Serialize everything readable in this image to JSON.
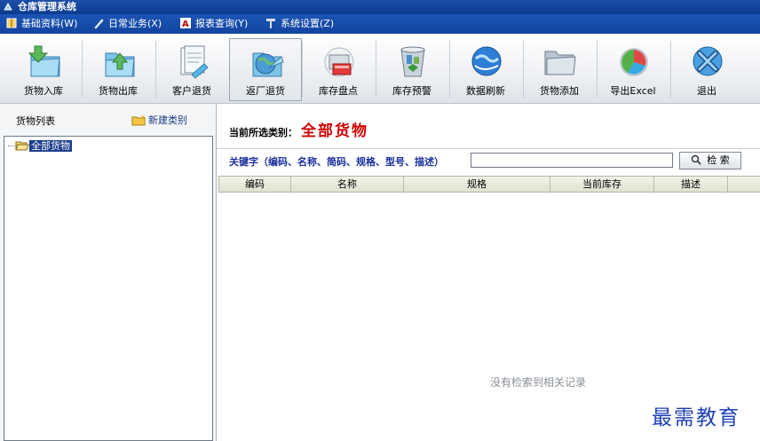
{
  "window": {
    "title": "仓库管理系统"
  },
  "menu": [
    {
      "label": "基础资料(W)",
      "icon": "book-icon"
    },
    {
      "label": "日常业务(X)",
      "icon": "pen-icon"
    },
    {
      "label": "报表查询(Y)",
      "icon": "report-icon"
    },
    {
      "label": "系统设置(Z)",
      "icon": "hammer-icon"
    }
  ],
  "toolbar": [
    {
      "label": "货物入库",
      "icon": "folder-in-icon"
    },
    {
      "label": "货物出库",
      "icon": "folder-out-icon"
    },
    {
      "label": "客户退货",
      "icon": "document-return-icon"
    },
    {
      "label": "返厂退货",
      "icon": "globe-folder-icon"
    },
    {
      "label": "库存盘点",
      "icon": "inventory-check-icon"
    },
    {
      "label": "库存预警",
      "icon": "recycle-bin-icon"
    },
    {
      "label": "数据刷新",
      "icon": "refresh-globe-icon"
    },
    {
      "label": "货物添加",
      "icon": "folder-add-icon"
    },
    {
      "label": "导出Excel",
      "icon": "excel-pie-icon"
    },
    {
      "label": "退出",
      "icon": "exit-icon"
    }
  ],
  "left_panel": {
    "title": "货物列表",
    "new_category": "新建类别",
    "tree_root": "全部货物"
  },
  "main": {
    "category_label": "当前所选类别：",
    "category_value": "全部货物",
    "keyword_label": "关键字（编码、名称、简码、规格、型号、描述）",
    "search_value": "",
    "search_button": "检 索",
    "columns": [
      "编码",
      "名称",
      "规格",
      "当前库存",
      "描述"
    ],
    "empty_message": "没有检索到相关记录"
  },
  "watermark": "最需教育",
  "colors": {
    "title_bar": "#0b3b8f",
    "menu_bar": "#1344a0",
    "category_value": "#d00000",
    "keyword_label": "#1a2f9c",
    "tree_selected": "#1c3d8c"
  }
}
